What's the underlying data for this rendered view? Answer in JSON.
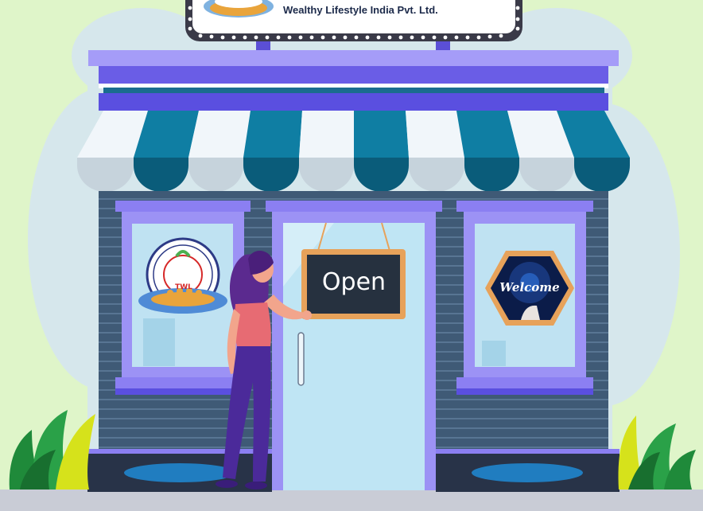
{
  "signboard": {
    "company_name": "Wealthy Lifestyle India Pvt. Ltd."
  },
  "door_sign": {
    "label": "Open"
  },
  "window_right": {
    "badge_text": "Welcome"
  },
  "window_left": {
    "logo_initials": "TWL"
  },
  "colors": {
    "background": "#dff5c9",
    "awning_dark": "#0f7ea3",
    "awning_light": "#f1f6fa",
    "shop_purple": "#7c6ff0",
    "shutter_slate": "#3f5a76",
    "door_glass": "#bfe5f4",
    "sign_frame": "#e7a25a",
    "ground": "#c9ccd6"
  }
}
